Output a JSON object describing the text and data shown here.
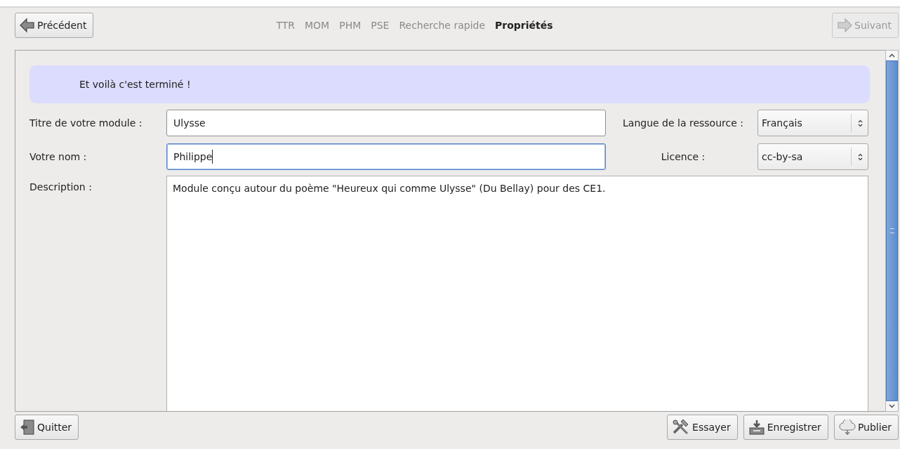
{
  "navigation": {
    "previous": {
      "label": "Précédent",
      "disabled": false
    },
    "next": {
      "label": "Suivant",
      "disabled": true
    },
    "steps": [
      {
        "label": "TTR",
        "selected": false
      },
      {
        "label": "MOM",
        "selected": false
      },
      {
        "label": "PHM",
        "selected": false
      },
      {
        "label": "PSE",
        "selected": false
      },
      {
        "label": "Recherche rapide",
        "selected": false
      },
      {
        "label": "Propriétés",
        "selected": true
      }
    ]
  },
  "banner": {
    "text": "Et voilà c'est terminé !"
  },
  "form": {
    "rows": [
      {
        "label": "Titre de votre module :",
        "value": "Ulysse",
        "focused": false,
        "select_label": "Langue de la ressource :",
        "select_value": "Français"
      },
      {
        "label": "Votre nom :",
        "value": "Philippe",
        "focused": true,
        "select_label": "Licence :",
        "select_value": "cc-by-sa"
      }
    ],
    "description": {
      "label": "Description :",
      "value": "Module conçu autour du poème \"Heureux qui comme Ulysse\" (Du Bellay) pour des CE1."
    }
  },
  "buttons": [
    {
      "kind": "quit",
      "label": "Quitter"
    },
    {
      "kind": "try",
      "label": "Essayer"
    },
    {
      "kind": "save",
      "label": "Enregistrer"
    },
    {
      "kind": "publish",
      "label": "Publier"
    }
  ]
}
